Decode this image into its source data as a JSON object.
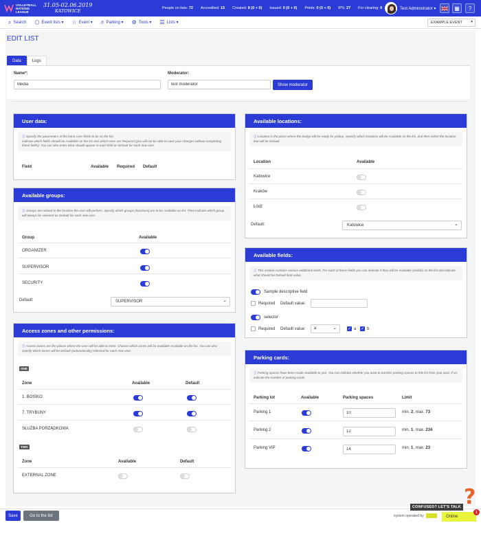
{
  "brand": {
    "logo_line1": "VOLLEYBALL",
    "logo_line2": "NATIONS LEAGUE",
    "event_dates": "31.05-02.06.2019",
    "event_city": "KATOWICE"
  },
  "stats": [
    {
      "label": "People on lists:",
      "value": "72"
    },
    {
      "label": "Accredited:",
      "value": "15"
    },
    {
      "label": "Created:",
      "value": "8 (0 + 0)"
    },
    {
      "label": "Issued:",
      "value": "0 (0 + 0)"
    },
    {
      "label": "Prints:",
      "value": "0 (0 + 0)"
    },
    {
      "label": "IPS:",
      "value": "27"
    },
    {
      "label": "For clearing:",
      "value": "6"
    }
  ],
  "user": {
    "name": "Test Administrator ▾"
  },
  "nav": {
    "search": "Search",
    "event_lists": "Event lists ▾",
    "event": "Event ▾",
    "parking": "Parking ▾",
    "tools": "Tools ▾",
    "lists": "Lists ▾"
  },
  "event_select": "EXAMPLE EVENT",
  "page": {
    "title": "EDIT LIST"
  },
  "tabs": {
    "data": "Data",
    "logs": "Logs"
  },
  "form": {
    "name_label": "Name*:",
    "name_value": "Media",
    "moderator_label": "Moderator:",
    "moderator_value": "test moderator",
    "show_moderator": "Show moderator"
  },
  "user_data": {
    "title": "User data:",
    "info_1": "Specify the parameters of the basic user fields to be on the list.",
    "info_2": "Indicate which fields should be Available on the list and which ones are Required (you will not be able to save your changes without completing these fields). You can also enter what should appear in each field as Default for each new user.",
    "col_field": "Field",
    "col_available": "Available",
    "col_required": "Required",
    "col_default": "Default"
  },
  "groups": {
    "title": "Available groups:",
    "info": "Groups are related to the function the user will perform. Specify which groups (functions) are to be Available on list. Then indicate which group will always be selected as Default for each new user.",
    "col_group": "Group",
    "col_available": "Available",
    "rows": [
      {
        "name": "ORGANIZER",
        "on": true
      },
      {
        "name": "SUPERVISOR",
        "on": true
      },
      {
        "name": "SECURITY",
        "on": true
      }
    ],
    "default_label": "Default:",
    "default_value": "SUPERVISOR"
  },
  "zones": {
    "title": "Access zones and other permissions:",
    "info": "Access zones are the places where the user will be able to enter. Choose which zones will be available Available on the list. You can also specify which zones will be Default (automatically) selected for each new user.",
    "tag_one": "ONE",
    "tag_two": "TWO",
    "col_zone": "Zone",
    "col_available": "Available",
    "col_default": "Default",
    "one_rows": [
      {
        "name": "1. BOISKO",
        "avail": true,
        "def": true
      },
      {
        "name": "7. TRYBUNY",
        "avail": true,
        "def": true
      },
      {
        "name": "SŁUŻBA PORZĄDKOWA",
        "avail": false,
        "def": false
      }
    ],
    "two_rows": [
      {
        "name": "EXTERNAL ZONE",
        "avail": false,
        "def": false
      }
    ]
  },
  "locations": {
    "title": "Available locations:",
    "info": "Location is the place where the badge will be ready for pickup. Specify which locations will be Available on the list, and then select the location that will be Default.",
    "col_location": "Location",
    "col_available": "Available",
    "rows": [
      {
        "name": "Katowice",
        "on": false
      },
      {
        "name": "Kraków",
        "on": false
      },
      {
        "name": "Łódź",
        "on": false
      }
    ],
    "default_label": "Default:",
    "default_value": "Katowice"
  },
  "fields": {
    "title": "Available fields:",
    "info": "This section contains various additional fields. For each of these fields you can indicate if they will be Available (visible) on the list and indicate what should be Default field value.",
    "field1": "Sample descriptive field",
    "field2": "selector",
    "required": "Required",
    "default_value": "Default value:",
    "select_value": "a",
    "opt_a": "a",
    "opt_b": "b"
  },
  "parking": {
    "title": "Parking cards:",
    "info": "Parking spaces have been made available to you. You can indicate whether you want to transfer parking spaces to this list from your pool. If so, indicate the number of parking cards.",
    "col_lot": "Parking lot",
    "col_available": "Available",
    "col_spaces": "Parking spaces",
    "col_limit": "Limit",
    "rows": [
      {
        "name": "Parking 1",
        "spaces": "10",
        "min": "2",
        "max": "73"
      },
      {
        "name": "Parking 2",
        "spaces": "12",
        "min": "1",
        "max": "234"
      },
      {
        "name": "Parking VIP",
        "spaces": "14",
        "min": "1",
        "max": "23"
      }
    ],
    "min_label": "min.",
    "max_label": ", max."
  },
  "footer": {
    "save": "Save",
    "back": "Go to the list",
    "system_operated": "system operated by",
    "online": "Online",
    "notif_count": "1",
    "confused": "CONFUSED? LET'S TALK"
  },
  "colors": {
    "primary": "#2b3bd6",
    "online": "#e9f53a",
    "help": "#e9622a"
  }
}
